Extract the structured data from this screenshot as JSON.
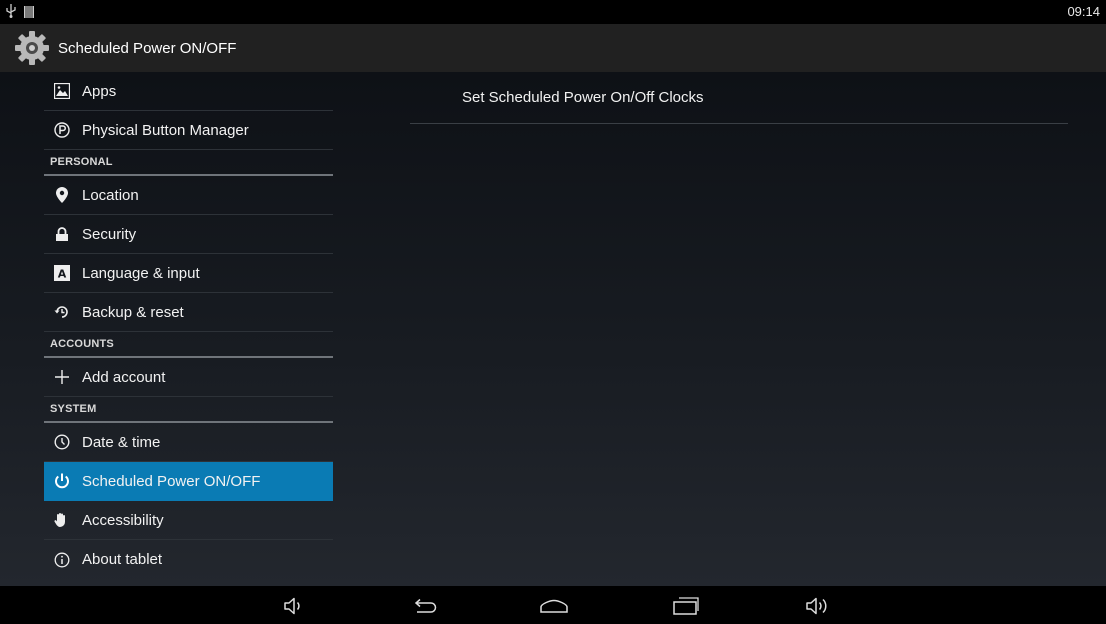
{
  "statusbar": {
    "time": "09:14",
    "icons": [
      "usb-icon",
      "storage-icon"
    ]
  },
  "actionbar": {
    "title": "Scheduled Power ON/OFF",
    "icon": "settings-gear-icon"
  },
  "sidebar": {
    "items": [
      {
        "type": "item",
        "label": "Apps",
        "icon": "apps-icon"
      },
      {
        "type": "item",
        "label": "Physical Button Manager",
        "icon": "p-circle-icon"
      },
      {
        "type": "header",
        "label": "PERSONAL"
      },
      {
        "type": "item",
        "label": "Location",
        "icon": "location-pin-icon"
      },
      {
        "type": "item",
        "label": "Security",
        "icon": "lock-icon"
      },
      {
        "type": "item",
        "label": "Language & input",
        "icon": "language-icon"
      },
      {
        "type": "item",
        "label": "Backup & reset",
        "icon": "backup-icon"
      },
      {
        "type": "header",
        "label": "ACCOUNTS"
      },
      {
        "type": "item",
        "label": "Add account",
        "icon": "plus-icon"
      },
      {
        "type": "header",
        "label": "SYSTEM"
      },
      {
        "type": "item",
        "label": "Date & time",
        "icon": "clock-icon"
      },
      {
        "type": "item",
        "label": "Scheduled Power ON/OFF",
        "icon": "power-icon",
        "selected": true
      },
      {
        "type": "item",
        "label": "Accessibility",
        "icon": "hand-icon"
      },
      {
        "type": "item",
        "label": "About tablet",
        "icon": "info-icon"
      }
    ]
  },
  "detail": {
    "items": [
      {
        "label": "Set Scheduled Power On/Off Clocks"
      }
    ]
  },
  "navbar": {
    "buttons": [
      "volume-down-icon",
      "back-icon",
      "home-icon",
      "recents-icon",
      "volume-up-icon"
    ]
  },
  "colors": {
    "accent": "#0a7bb4",
    "actionbar": "#212121"
  }
}
